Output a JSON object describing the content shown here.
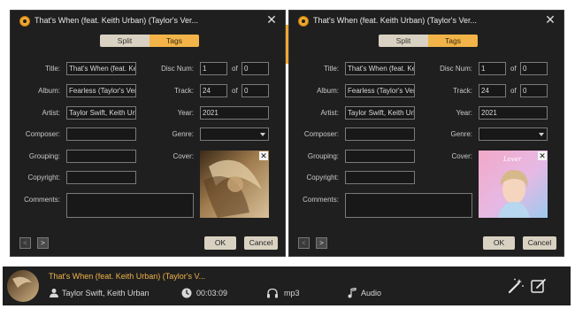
{
  "dialogs": [
    {
      "window_title": "That's When (feat. Keith Urban) (Taylor's Ver...",
      "tabs": {
        "split": "Split",
        "tags": "Tags"
      },
      "labels": {
        "title": "Title:",
        "album": "Album:",
        "artist": "Artist:",
        "composer": "Composer:",
        "grouping": "Grouping:",
        "copyright": "Copyright:",
        "comments": "Comments:",
        "disc_num": "Disc Num:",
        "of1": "of",
        "track": "Track:",
        "of2": "of",
        "year": "Year:",
        "genre": "Genre:",
        "cover": "Cover:"
      },
      "values": {
        "title": "That's When (feat. Ke",
        "album": "Fearless (Taylor's Vers",
        "artist": "Taylor Swift, Keith Urb",
        "composer": "",
        "grouping": "",
        "copyright": "",
        "comments": "",
        "disc_num": "1",
        "disc_total": "0",
        "track": "24",
        "track_total": "0",
        "year": "2021",
        "genre": ""
      },
      "cover_style": "sepia",
      "buttons": {
        "prev": "<",
        "next": ">",
        "ok": "OK",
        "cancel": "Cancel"
      }
    },
    {
      "window_title": "That's When (feat. Keith Urban) (Taylor's Ver...",
      "tabs": {
        "split": "Split",
        "tags": "Tags"
      },
      "labels": {
        "title": "Title:",
        "album": "Album:",
        "artist": "Artist:",
        "composer": "Composer:",
        "grouping": "Grouping:",
        "copyright": "Copyright:",
        "comments": "Comments:",
        "disc_num": "Disc Num:",
        "of1": "of",
        "track": "Track:",
        "of2": "of",
        "year": "Year:",
        "genre": "Genre:",
        "cover": "Cover:"
      },
      "values": {
        "title": "That's When (feat. Ke",
        "album": "Fearless (Taylor's Vers",
        "artist": "Taylor Swift, Keith Urb",
        "composer": "",
        "grouping": "",
        "copyright": "",
        "comments": "",
        "disc_num": "1",
        "disc_total": "0",
        "track": "24",
        "track_total": "0",
        "year": "2021",
        "genre": ""
      },
      "cover_style": "pastel",
      "cover_text": "Lover",
      "buttons": {
        "prev": "<",
        "next": ">",
        "ok": "OK",
        "cancel": "Cancel"
      }
    }
  ],
  "bottom_bar": {
    "song_title": "That's When (feat. Keith Urban) (Taylor's V...",
    "artist": "Taylor Swift, Keith Urban",
    "duration": "00:03:09",
    "format": "mp3",
    "type": "Audio",
    "icons": [
      "user-icon",
      "clock-icon",
      "headphones-icon",
      "music-note-icon",
      "magic-wand-icon",
      "edit-icon"
    ]
  },
  "colors": {
    "accent": "#f2b448",
    "panel": "#1f1f1f"
  }
}
